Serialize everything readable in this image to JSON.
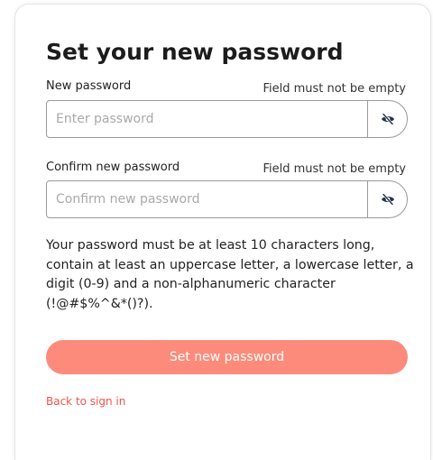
{
  "form": {
    "title": "Set your new password",
    "new_password": {
      "label": "New password",
      "error": "Field must not be empty",
      "placeholder": "Enter password",
      "value": ""
    },
    "confirm_password": {
      "label": "Confirm new password",
      "error": "Field must not be empty",
      "placeholder": "Confirm new password",
      "value": ""
    },
    "requirements": "Your password must be at least 10 characters long, contain at least an uppercase letter, a lowercase letter, a digit (0-9) and a non-alphanumeric character (!@#$%^&*()?).",
    "submit_label": "Set new password",
    "back_link": "Back to sign in"
  },
  "icons": {
    "toggle_visibility": "eye-slash-icon"
  },
  "colors": {
    "primary_button": "#fc8b7c",
    "link": "#f0544a",
    "border": "#9a9a9a",
    "icon_fill": "#23344a"
  }
}
